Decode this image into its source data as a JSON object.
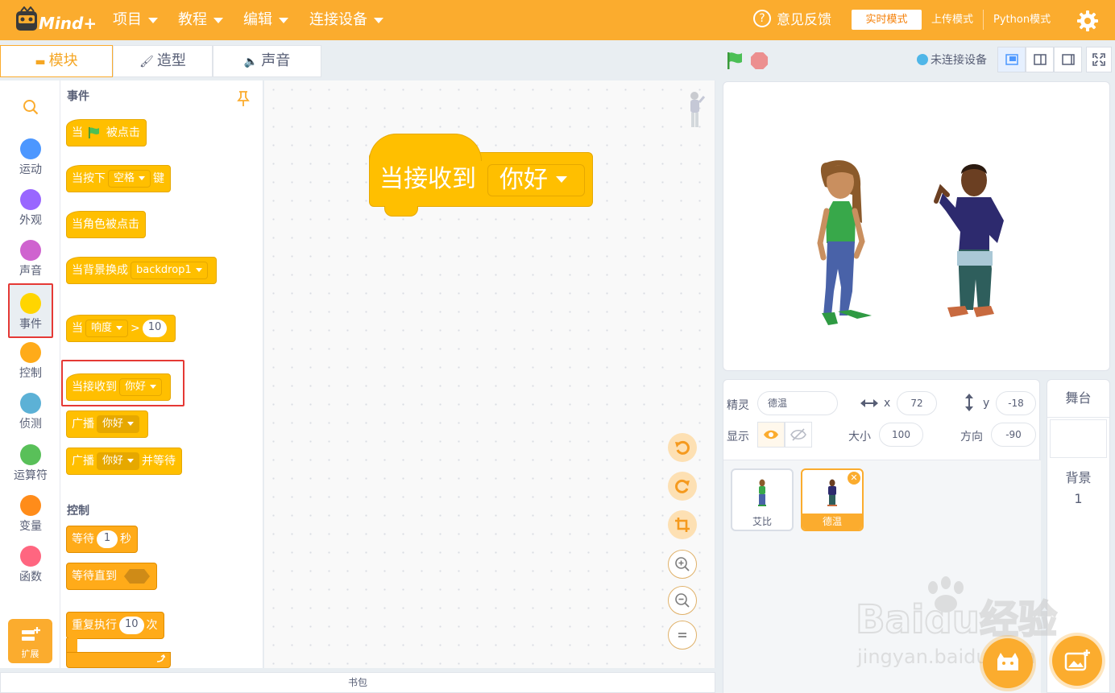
{
  "app": {
    "logo_text": "Mind+"
  },
  "menu": [
    {
      "label": "项目"
    },
    {
      "label": "教程"
    },
    {
      "label": "编辑"
    },
    {
      "label": "连接设备"
    }
  ],
  "header": {
    "feedback": "意见反馈",
    "modes": [
      "实时模式",
      "上传模式",
      "Python模式"
    ]
  },
  "tabs": [
    "模块",
    "造型",
    "声音"
  ],
  "connection": "未连接设备",
  "categories": [
    {
      "label": "运动",
      "color": "#4c97ff"
    },
    {
      "label": "外观",
      "color": "#9966ff"
    },
    {
      "label": "声音",
      "color": "#cf63cf"
    },
    {
      "label": "事件",
      "color": "#ffd500"
    },
    {
      "label": "控制",
      "color": "#ffab19"
    },
    {
      "label": "侦测",
      "color": "#5cb1d6"
    },
    {
      "label": "运算符",
      "color": "#59c059"
    },
    {
      "label": "变量",
      "color": "#ff8c1a"
    },
    {
      "label": "函数",
      "color": "#ff6680"
    }
  ],
  "extension_label": "扩展",
  "palette": {
    "events_title": "事件",
    "flag_clicked": {
      "pre": "当",
      "post": "被点击"
    },
    "key_pressed": {
      "pre": "当按下",
      "key": "空格",
      "post": "键"
    },
    "sprite_clicked": "当角色被点击",
    "backdrop_switch": {
      "pre": "当背景换成",
      "value": "backdrop1"
    },
    "greater_than": {
      "pre": "当",
      "option": "响度",
      "op": ">",
      "value": "10"
    },
    "receive": {
      "pre": "当接收到",
      "value": "你好"
    },
    "broadcast": {
      "pre": "广播",
      "value": "你好"
    },
    "broadcast_wait": {
      "pre": "广播",
      "value": "你好",
      "post": "并等待"
    },
    "control_title": "控制",
    "wait": {
      "pre": "等待",
      "value": "1",
      "post": "秒"
    },
    "wait_until": "等待直到",
    "repeat": {
      "pre": "重复执行",
      "value": "10",
      "post": "次"
    }
  },
  "code_block": {
    "label": "当接收到",
    "value": "你好"
  },
  "backpack": "书包",
  "sprite_info": {
    "sprite_label": "精灵",
    "sprite_name": "德温",
    "x_label": "x",
    "x": "72",
    "y_label": "y",
    "y": "-18",
    "show_label": "显示",
    "size_label": "大小",
    "size": "100",
    "direction_label": "方向",
    "direction": "-90"
  },
  "sprites": [
    {
      "name": "艾比",
      "selected": false
    },
    {
      "name": "德温",
      "selected": true
    }
  ],
  "stage_panel": {
    "title": "舞台",
    "backdrop_label": "背景",
    "backdrop_count": "1"
  },
  "watermark": {
    "text": "Baidu经验",
    "url": "jingyan.baidu.com"
  },
  "colors": {
    "brand": "#fbac2e",
    "event_block": "#ffbf00",
    "control_block": "#ffab19"
  }
}
